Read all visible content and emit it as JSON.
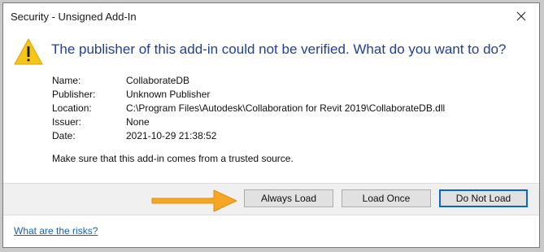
{
  "window": {
    "title": "Security - Unsigned Add-In",
    "close_icon": "close-icon"
  },
  "dialog": {
    "icon": "warning-icon",
    "warning_color": "#f5c518",
    "headline": "The publisher of this add-in could not be verified. What do you want to do?",
    "details": [
      {
        "label": "Name:",
        "value": "CollaborateDB"
      },
      {
        "label": "Publisher:",
        "value": "Unknown Publisher"
      },
      {
        "label": "Location:",
        "value": "C:\\Program Files\\Autodesk\\Collaboration for Revit 2019\\CollaborateDB.dll"
      },
      {
        "label": "Issuer:",
        "value": "None"
      },
      {
        "label": "Date:",
        "value": "2021-10-29 21:38:52"
      }
    ],
    "trust_message": "Make sure that this add-in comes from a trusted source."
  },
  "buttons": {
    "always_load": "Always Load",
    "load_once": "Load Once",
    "do_not_load": "Do Not Load"
  },
  "annotation": {
    "arrow_color": "#f5a623"
  },
  "footer": {
    "risks_link": "What are the risks?"
  }
}
